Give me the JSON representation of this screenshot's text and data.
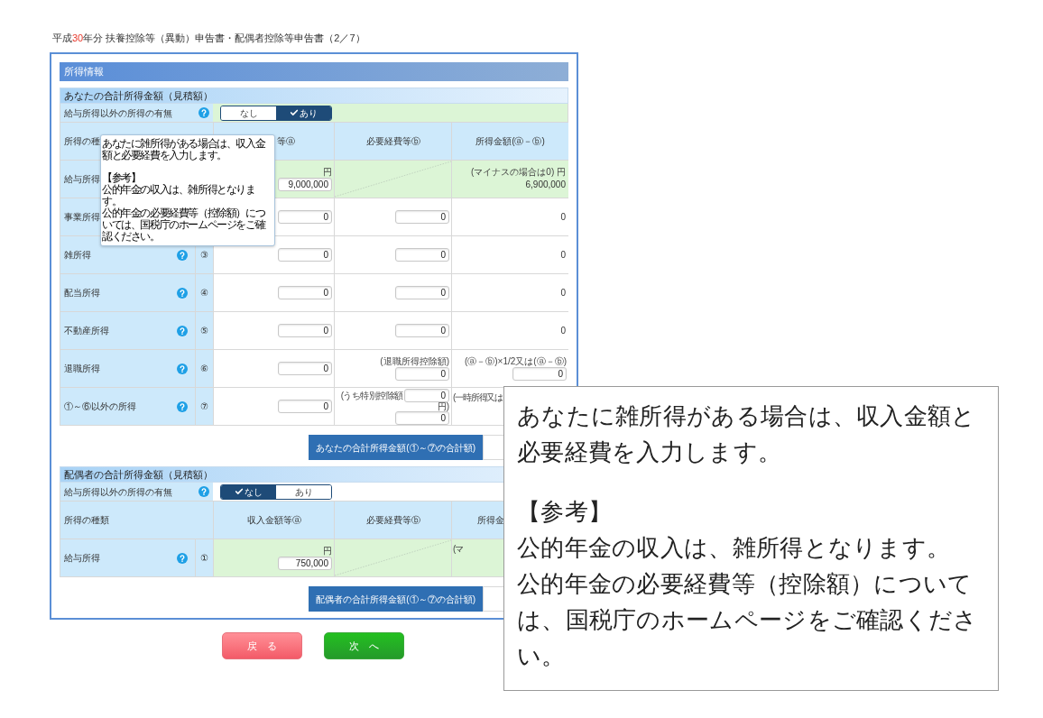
{
  "title": {
    "prefix": "平成",
    "year": "30",
    "suffix": "年分 扶養控除等（異動）申告書・配偶者控除等申告書（2／7）"
  },
  "panel_title": "所得情報",
  "sections": [
    {
      "title": "あなたの合計所得金額（見積額）",
      "toggle_label": "給与所得以外の所得の有無",
      "options": [
        {
          "label": "なし",
          "selected": false
        },
        {
          "label": "あり",
          "selected": true
        }
      ],
      "headers": [
        {
          "label": "所得の種",
          "kind": "left"
        },
        {
          "label": "等ⓐ",
          "kind": "tail"
        },
        {
          "label": "必要経費等ⓑ",
          "kind": "center"
        },
        {
          "label": "所得金額(ⓐ－ⓑ)",
          "kind": "center"
        }
      ],
      "rows": [
        {
          "label": "給与所得",
          "highlight": true,
          "cells": [
            {
              "kind": "input",
              "unit": "円",
              "value": "9,000,000"
            },
            {
              "kind": "slash"
            },
            {
              "kind": "text",
              "note": "(マイナスの場合は0) 円",
              "value": "6,900,000"
            }
          ]
        },
        {
          "label": "事業所得",
          "highlight": false,
          "cells": [
            {
              "kind": "input",
              "value": "0"
            },
            {
              "kind": "input",
              "value": "0"
            },
            {
              "kind": "text",
              "value": "0"
            }
          ]
        },
        {
          "label": "雑所得",
          "help": true,
          "number": "③",
          "highlight": false,
          "cells": [
            {
              "kind": "input",
              "value": "0"
            },
            {
              "kind": "input",
              "value": "0"
            },
            {
              "kind": "text",
              "value": "0"
            }
          ]
        },
        {
          "label": "配当所得",
          "help": true,
          "number": "④",
          "highlight": false,
          "cells": [
            {
              "kind": "input",
              "value": "0"
            },
            {
              "kind": "input",
              "value": "0"
            },
            {
              "kind": "text",
              "value": "0"
            }
          ]
        },
        {
          "label": "不動産所得",
          "help": true,
          "number": "⑤",
          "highlight": false,
          "cells": [
            {
              "kind": "input",
              "value": "0"
            },
            {
              "kind": "input",
              "value": "0"
            },
            {
              "kind": "text",
              "value": "0"
            }
          ]
        },
        {
          "label": "退職所得",
          "help": true,
          "number": "⑥",
          "highlight": false,
          "cells": [
            {
              "kind": "input",
              "value": "0"
            },
            {
              "kind": "input",
              "note": "(退職所得控除額)",
              "value": "0"
            },
            {
              "kind": "input",
              "note": "(ⓐ－ⓑ)×1/2又は(ⓐ－ⓑ)",
              "value": "0"
            }
          ]
        },
        {
          "label": "①～⑥以外の所得",
          "help": true,
          "number": "⑦",
          "highlight": false,
          "cells": [
            {
              "kind": "input",
              "value": "0"
            },
            {
              "kind": "split",
              "prefix": "(うち特別控除額",
              "value": "0",
              "unit": "円)",
              "value2": "0"
            },
            {
              "kind": "partial",
              "note": "(一時所得又は"
            }
          ]
        }
      ],
      "total_label": "あなたの合計所得金額(①～⑦の合計額)"
    },
    {
      "title": "配偶者の合計所得金額（見積額）",
      "toggle_label": "給与所得以外の所得の有無",
      "options": [
        {
          "label": "なし",
          "selected": true
        },
        {
          "label": "あり",
          "selected": false
        }
      ],
      "headers": [
        {
          "label": "所得の種類",
          "kind": "left"
        },
        {
          "label": "収入金額等ⓐ",
          "kind": "center"
        },
        {
          "label": "必要経費等ⓑ",
          "kind": "center"
        },
        {
          "label": "所得金",
          "kind": "head"
        }
      ],
      "rows": [
        {
          "label": "給与所得",
          "help": true,
          "number": "①",
          "highlight": true,
          "cells": [
            {
              "kind": "input",
              "unit": "円",
              "value": "750,000"
            },
            {
              "kind": "slash"
            },
            {
              "kind": "partial",
              "note": "(マ"
            }
          ]
        }
      ],
      "total_label": "配偶者の合計所得金額(①～⑦の合計額)"
    }
  ],
  "buttons": [
    {
      "label": "戻　る",
      "kind": "back"
    },
    {
      "label": "次　へ",
      "kind": "next"
    }
  ],
  "tooltip": [
    "あなたに雑所得がある場合は、収入金額と必要経費を入力します。",
    "【参考】",
    "公的年金の収入は、雑所得となります。",
    "公的年金の必要経費等（控除額）については、国税庁のホームページをご確認ください。"
  ],
  "callout": [
    "あなたに雑所得がある場合は、収入金額と必要経費を入力します。",
    "【参考】",
    "公的年金の収入は、雑所得となります。",
    "公的年金の必要経費等（控除額）については、国税庁のホームページをご確認ください。"
  ]
}
